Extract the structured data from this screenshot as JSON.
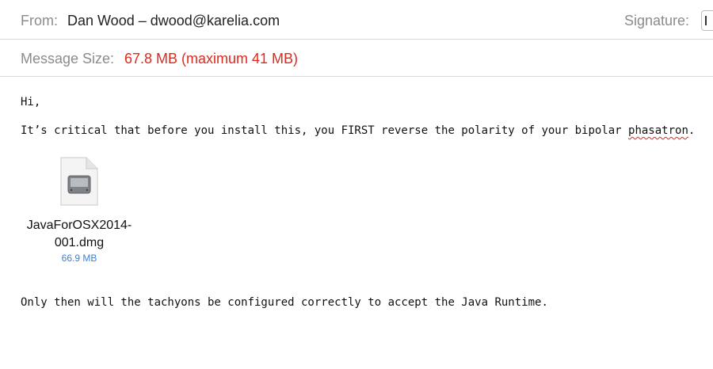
{
  "header": {
    "from_label": "From:",
    "from_value": "Dan Wood – dwood@karelia.com",
    "signature_label": "Signature:",
    "message_size_label": "Message Size:",
    "message_size_value": "67.8 MB (maximum 41 MB)"
  },
  "body": {
    "greeting": "Hi,",
    "critical_prefix": "It’s critical that before you install this, you FIRST reverse the polarity of your bipolar ",
    "critical_misspelled": "phasatron",
    "critical_suffix": ".",
    "closing": "Only then will the tachyons be configured correctly to accept the Java Runtime."
  },
  "attachment": {
    "name_line1": "JavaForOSX2014-",
    "name_line2": "001.dmg",
    "size": "66.9 MB",
    "icon": "disk-image-file-icon"
  },
  "colors": {
    "error_red": "#e0281c",
    "link_blue": "#3a82d4",
    "label_gray": "#8b8b8b"
  }
}
